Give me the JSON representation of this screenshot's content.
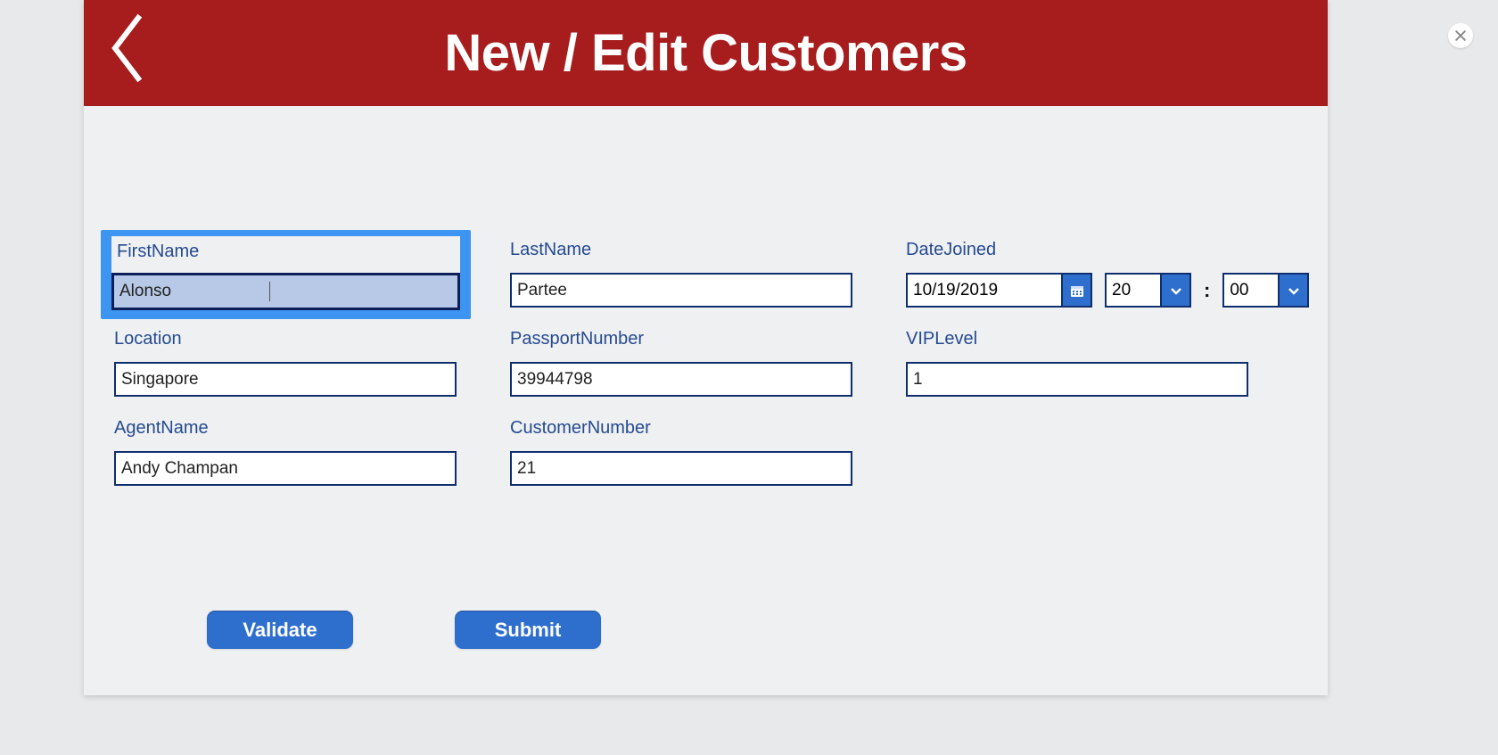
{
  "header": {
    "title": "New / Edit Customers"
  },
  "fields": {
    "first_name": {
      "label": "FirstName",
      "value": "Alonso"
    },
    "last_name": {
      "label": "LastName",
      "value": "Partee"
    },
    "date_joined": {
      "label": "DateJoined",
      "date": "10/19/2019",
      "hour": "20",
      "minute": "00"
    },
    "location": {
      "label": "Location",
      "value": "Singapore"
    },
    "passport_number": {
      "label": "PassportNumber",
      "value": "39944798"
    },
    "vip_level": {
      "label": "VIPLevel",
      "value": "1"
    },
    "agent_name": {
      "label": "AgentName",
      "value": "Andy Champan"
    },
    "customer_number": {
      "label": "CustomerNumber",
      "value": "21"
    }
  },
  "buttons": {
    "validate": "Validate",
    "submit": "Submit"
  },
  "separators": {
    "time": ":"
  }
}
